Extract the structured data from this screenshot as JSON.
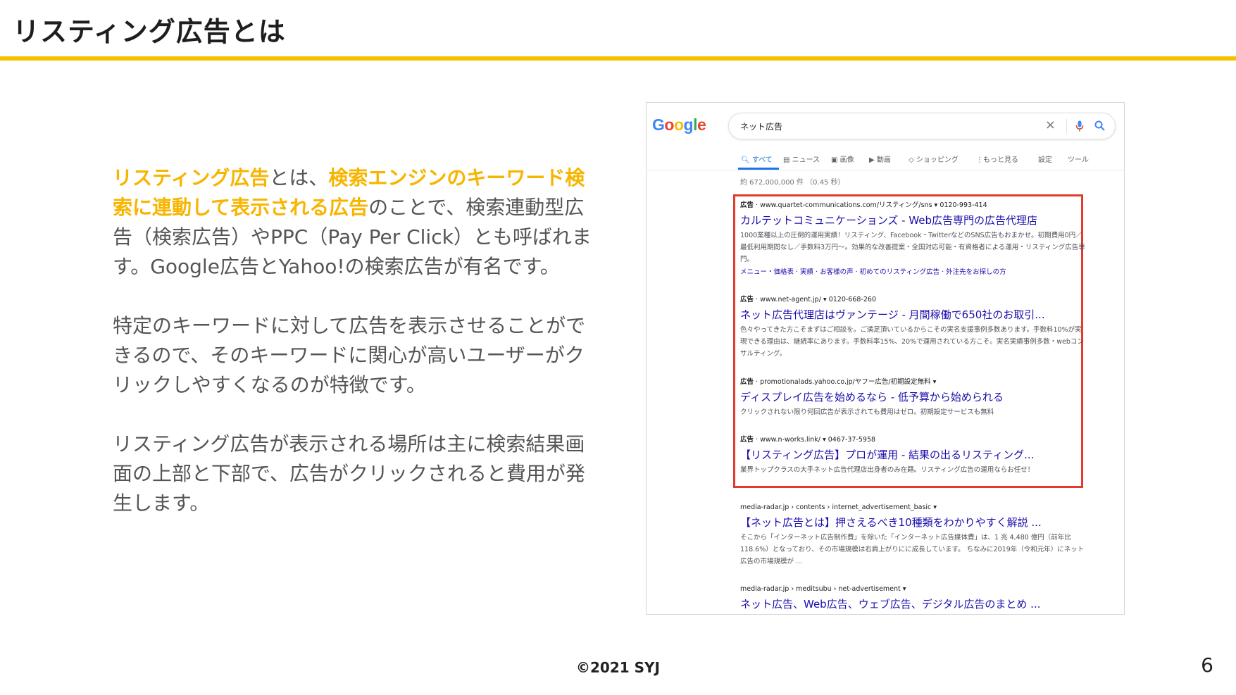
{
  "slide": {
    "title": "リスティング広告とは",
    "body": {
      "p1": {
        "hl1": "リスティング広告",
        "t1": "とは、",
        "hl2": "検索エンジンのキーワード検索に連動して表示される広告",
        "t2": "のことで、検索連動型広告（検索広告）やPPC（Pay Per Click）とも呼ばれます。Google広告とYahoo!の検索広告が有名です。"
      },
      "p2": "特定のキーワードに対して広告を表示させることができるので、そのキーワードに関心が高いユーザーがクリックしやすくなるのが特徴です。",
      "p3": "リスティング広告が表示される場所は主に検索結果画面の上部と下部で、広告がクリックされると費用が発生します。"
    },
    "footer": "©2021 SYJ",
    "page_number": "6"
  },
  "serp": {
    "logo": [
      "G",
      "o",
      "o",
      "g",
      "l",
      "e"
    ],
    "query": "ネット広告",
    "tabs": {
      "all": "すべて",
      "news": "ニュース",
      "images": "画像",
      "videos": "動画",
      "shopping": "ショッピング",
      "more": "もっと見る",
      "settings": "設定",
      "tools": "ツール"
    },
    "stats": "約 672,000,000 件 （0.45 秒）",
    "ads": [
      {
        "badge": "広告",
        "url": "· www.quartet-communications.com/リスティング/sns ▾ 0120-993-414",
        "title": "カルテットコミュニケーションズ - Web広告専門の広告代理店",
        "desc": "1000業種以上の圧倒的運用実績！リスティング、Facebook・TwitterなどのSNS広告もおまかせ。初期費用0円／最低利用期間なし／手数料3万円〜。効果的な改善提案・全国対応可能・有資格者による運用・リスティング広告専門。",
        "links": "メニュー・価格表 · 実績 · お客様の声 · 初めてのリスティング広告 · 外注先をお探しの方"
      },
      {
        "badge": "広告",
        "url": "· www.net-agent.jp/ ▾ 0120-668-260",
        "title": "ネット広告代理店はヴァンテージ - 月間稼働で650社のお取引...",
        "desc": "色々やってきた方こそまずはご相談を。ご満足頂いているからこその実名支援事例多数あります。手数料10%が実現できる理由は、継続率にあります。手数料率15%、20%で運用されている方こそ。実名実績事例多数・webコンサルティング。",
        "links": ""
      },
      {
        "badge": "広告",
        "url": "· promotionalads.yahoo.co.jp/ヤフー広告/初期設定無料 ▾",
        "title": "ディスプレイ広告を始めるなら - 低予算から始められる",
        "desc": "クリックされない限り何回広告が表示されても費用はゼロ。初期設定サービスも無料",
        "links": ""
      },
      {
        "badge": "広告",
        "url": "· www.n-works.link/ ▾ 0467-37-5958",
        "title": "【リスティング広告】プロが運用 - 結果の出るリスティング...",
        "desc": "業界トップクラスの大手ネット広告代理店出身者のみ在籍。リスティング広告の運用ならお任せ！",
        "links": ""
      }
    ],
    "organic": [
      {
        "url": "media-radar.jp › contents › internet_advertisement_basic ▾",
        "title": "【ネット広告とは】押さえるべき10種類をわかりやすく解説 ...",
        "desc": "そこから「インターネット広告制作費」を除いた「インターネット広告媒体費」は、1 兆 4,480 億円（前年比118.6%）となっており、その市場規模は右肩上がりにに成長しています。 ちなみに2019年（令和元年）にネット広告の市場規模が ..."
      },
      {
        "url": "media-radar.jp › meditsubu › net-advertisement ▾",
        "title": "ネット広告、Web広告、ウェブ広告、デジタル広告のまとめ ...",
        "desc": ""
      }
    ]
  }
}
